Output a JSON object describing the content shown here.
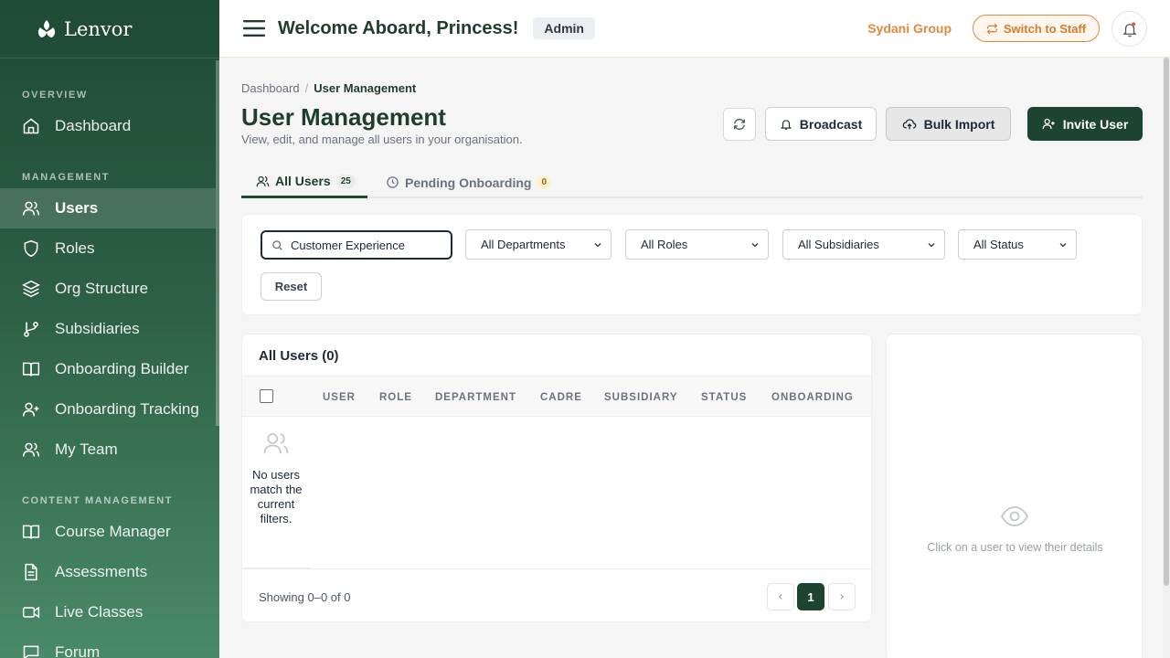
{
  "app": {
    "name": "Lenvor"
  },
  "sidebar": {
    "sections": [
      {
        "label": "OVERVIEW"
      },
      {
        "label": "MANAGEMENT"
      },
      {
        "label": "CONTENT MANAGEMENT"
      }
    ],
    "items": [
      {
        "label": "Dashboard",
        "icon": "home-icon"
      },
      {
        "label": "Users",
        "icon": "users-icon",
        "active": true
      },
      {
        "label": "Roles",
        "icon": "shield-icon"
      },
      {
        "label": "Org Structure",
        "icon": "layers-icon"
      },
      {
        "label": "Subsidiaries",
        "icon": "git-branch-icon"
      },
      {
        "label": "Onboarding Builder",
        "icon": "book-open-icon"
      },
      {
        "label": "Onboarding Tracking",
        "icon": "user-plus-icon"
      },
      {
        "label": "My Team",
        "icon": "users-icon"
      },
      {
        "label": "Course Manager",
        "icon": "book-open-icon"
      },
      {
        "label": "Assessments",
        "icon": "file-text-icon"
      },
      {
        "label": "Live Classes",
        "icon": "video-icon"
      },
      {
        "label": "Forum",
        "icon": "message-square-icon"
      }
    ]
  },
  "header": {
    "welcome": "Welcome Aboard, Princess!",
    "role_badge": "Admin",
    "org_name": "Sydani Group",
    "switch_label": "Switch to Staff"
  },
  "breadcrumb": {
    "parent": "Dashboard",
    "current": "User Management"
  },
  "page": {
    "title": "User Management",
    "subtitle": "View, edit, and manage all users in your organisation."
  },
  "actions": {
    "broadcast": "Broadcast",
    "bulk_import": "Bulk Import",
    "invite_user": "Invite User"
  },
  "tabs": [
    {
      "label": "All Users",
      "count": "25"
    },
    {
      "label": "Pending Onboarding",
      "count": "0"
    }
  ],
  "filters": {
    "search_value": "Customer Experience",
    "department": "All Departments",
    "role": "All Roles",
    "subsidiary": "All Subsidiaries",
    "status": "All Status",
    "reset": "Reset"
  },
  "table": {
    "title": "All Users (0)",
    "columns": [
      "USER",
      "ROLE",
      "DEPARTMENT",
      "CADRE",
      "SUBSIDIARY",
      "STATUS",
      "ONBOARDING"
    ],
    "empty_message": "No users match the current filters.",
    "showing": "Showing 0–0 of 0",
    "current_page": "1"
  },
  "detail": {
    "placeholder": "Click on a user to view their details"
  },
  "colors": {
    "brand": "#1d4430",
    "accent": "#e08a3c"
  }
}
